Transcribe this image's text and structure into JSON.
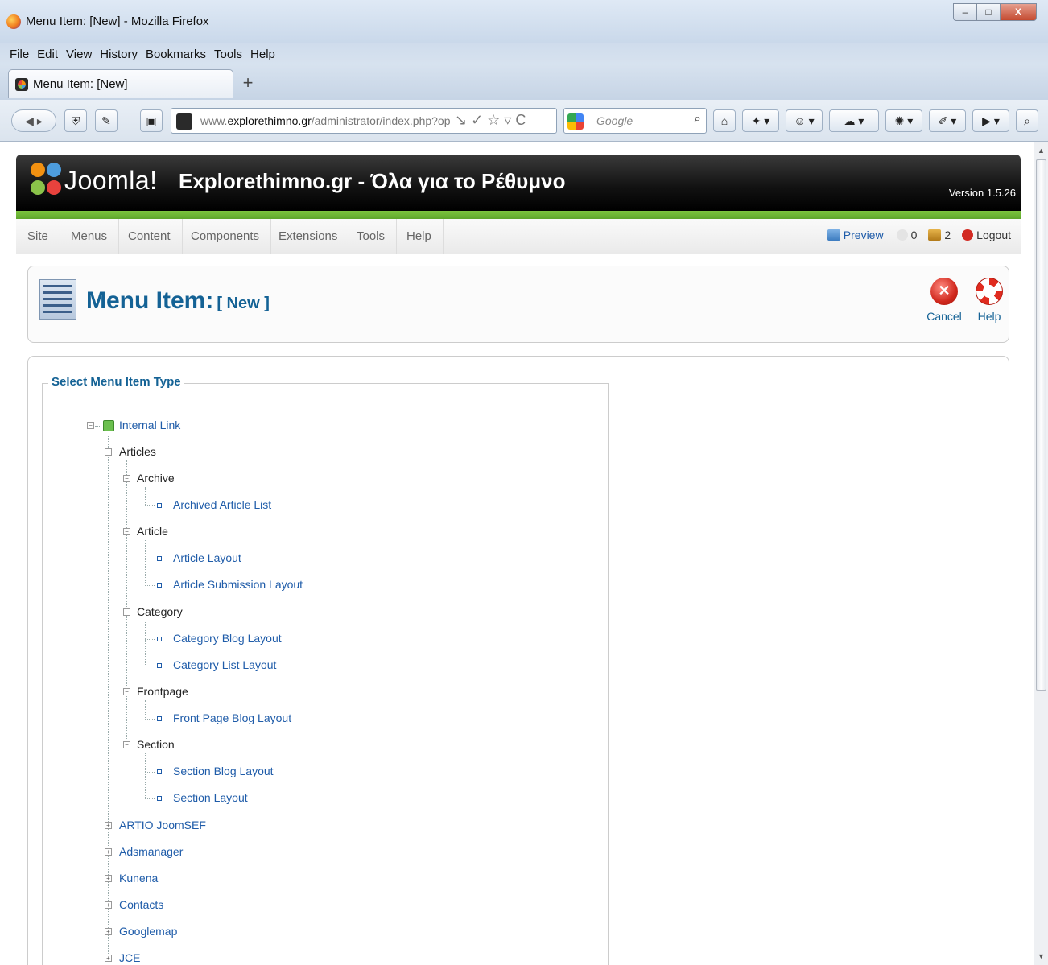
{
  "browser": {
    "window_title": "Menu Item: [New] - Mozilla Firefox",
    "window_buttons": {
      "minimize": "–",
      "maximize": "□",
      "close": "X"
    },
    "menu": [
      "File",
      "Edit",
      "View",
      "History",
      "Bookmarks",
      "Tools",
      "Help"
    ],
    "tab_title": "Menu Item: [New]",
    "new_tab": "+",
    "url_prefix": "www.",
    "url_domain": "explorethimno.gr",
    "url_path": "/administrator/index.php?op",
    "url_icons": "↘ ✓ ☆ ▿ C",
    "search_placeholder": "Google",
    "search_icon": "⌕",
    "back_glyph": "◀ ▸",
    "home_glyph": "⌂"
  },
  "joomla": {
    "logo_text": "Joomla!",
    "site_title": "Explorethimno.gr - Όλα για το Ρέθυμνο",
    "version": "Version 1.5.26",
    "menu": [
      "Site",
      "Menus",
      "Content",
      "Components",
      "Extensions",
      "Tools",
      "Help"
    ],
    "status": {
      "preview": "Preview",
      "messages": "0",
      "users": "2",
      "logout": "Logout"
    },
    "page_title": "Menu Item:",
    "page_subtitle": "[ New ]",
    "buttons": {
      "cancel": "Cancel",
      "help": "Help"
    },
    "legend": "Select Menu Item Type",
    "tree": {
      "root": "Internal Link",
      "articles": "Articles",
      "archive": "Archive",
      "archived_article_list": "Archived Article List",
      "article": "Article",
      "article_layout": "Article Layout",
      "article_submission_layout": "Article Submission Layout",
      "category": "Category",
      "category_blog_layout": "Category Blog Layout",
      "category_list_layout": "Category List Layout",
      "frontpage": "Frontpage",
      "front_page_blog_layout": "Front Page Blog Layout",
      "section": "Section",
      "section_blog_layout": "Section Blog Layout",
      "section_layout": "Section Layout",
      "artio_joomsef": "ARTIO JoomSEF",
      "adsmanager": "Adsmanager",
      "kunena": "Kunena",
      "contacts": "Contacts",
      "googlemap": "Googlemap",
      "jce": "JCE"
    }
  },
  "colors": {
    "link": "#1f5ca9",
    "title_blue": "#146295",
    "joomla_green": "#6cb536",
    "header_black": "#111111"
  }
}
